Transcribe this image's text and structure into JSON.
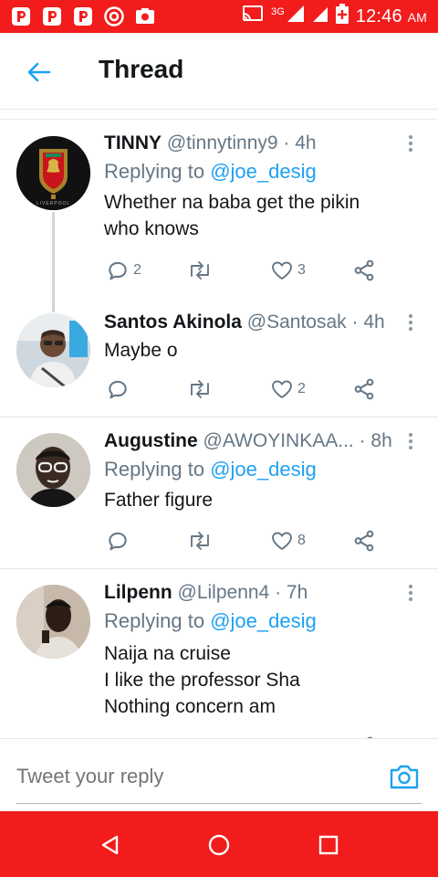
{
  "status_bar": {
    "time": "12:46",
    "ampm": "AM",
    "network": "3G",
    "notif_icons": [
      "p-app-icon",
      "p-app-icon",
      "p-app-icon",
      "opera-icon",
      "camera-notif-icon"
    ]
  },
  "header": {
    "title": "Thread"
  },
  "tweets": [
    {
      "name": "TINNY",
      "handle": "@tinnytinny9",
      "time": "· 4h",
      "replying_prefix": "Replying to ",
      "replying_to": "@joe_desig",
      "text": "Whether na baba get the pikin who knows",
      "replies": "2",
      "retweets": "",
      "likes": "3",
      "avatar_badge": "LIVERPOOL"
    },
    {
      "name": "Santos Akinola",
      "handle": "@Santosak",
      "time": "· 4h",
      "text": "Maybe o",
      "replies": "",
      "retweets": "",
      "likes": "2"
    },
    {
      "name": "Augustine",
      "handle": "@AWOYINKAA...",
      "time": "· 8h",
      "replying_prefix": "Replying to ",
      "replying_to": "@joe_desig",
      "text": "Father figure",
      "replies": "",
      "retweets": "",
      "likes": "8"
    },
    {
      "name": "Lilpenn",
      "handle": "@Lilpenn4",
      "time": "· 7h",
      "replying_prefix": "Replying to ",
      "replying_to": "@joe_desig",
      "text_lines": [
        "Naija na cruise",
        "I like the professor Sha",
        "Nothing concern am"
      ]
    }
  ],
  "reply_bar": {
    "placeholder": "Tweet your reply"
  },
  "colors": {
    "status_bar": "#f21c1c",
    "accent": "#1da1f2",
    "muted": "#657786"
  }
}
